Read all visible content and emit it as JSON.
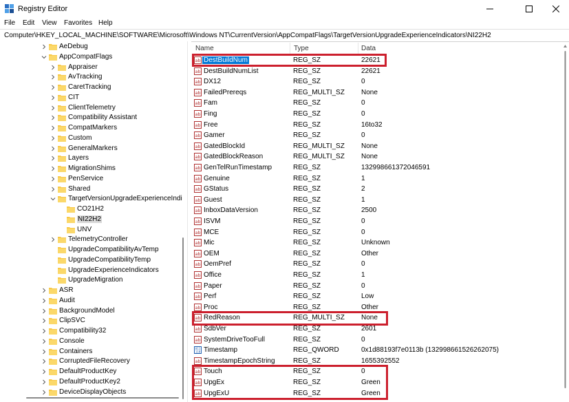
{
  "window": {
    "title": "Registry Editor"
  },
  "menu": [
    "File",
    "Edit",
    "View",
    "Favorites",
    "Help"
  ],
  "address": "Computer\\HKEY_LOCAL_MACHINE\\SOFTWARE\\Microsoft\\Windows NT\\CurrentVersion\\AppCompatFlags\\TargetVersionUpgradeExperienceIndicators\\NI22H2",
  "tree": [
    {
      "label": "AeDebug",
      "level": 3,
      "chev": "right"
    },
    {
      "label": "AppCompatFlags",
      "level": 3,
      "chev": "down"
    },
    {
      "label": "Appraiser",
      "level": 4,
      "chev": "right"
    },
    {
      "label": "AvTracking",
      "level": 4,
      "chev": "right"
    },
    {
      "label": "CaretTracking",
      "level": 4,
      "chev": "right"
    },
    {
      "label": "CIT",
      "level": 4,
      "chev": "right"
    },
    {
      "label": "ClientTelemetry",
      "level": 4,
      "chev": "right"
    },
    {
      "label": "Compatibility Assistant",
      "level": 4,
      "chev": "right"
    },
    {
      "label": "CompatMarkers",
      "level": 4,
      "chev": "right"
    },
    {
      "label": "Custom",
      "level": 4,
      "chev": "right"
    },
    {
      "label": "GeneralMarkers",
      "level": 4,
      "chev": "right"
    },
    {
      "label": "Layers",
      "level": 4,
      "chev": "right"
    },
    {
      "label": "MigrationShims",
      "level": 4,
      "chev": "right"
    },
    {
      "label": "PenService",
      "level": 4,
      "chev": "right"
    },
    {
      "label": "Shared",
      "level": 4,
      "chev": "right"
    },
    {
      "label": "TargetVersionUpgradeExperienceIndi",
      "level": 4,
      "chev": "down"
    },
    {
      "label": "CO21H2",
      "level": 5,
      "chev": "none"
    },
    {
      "label": "NI22H2",
      "level": 5,
      "chev": "none",
      "selected": true
    },
    {
      "label": "UNV",
      "level": 5,
      "chev": "none"
    },
    {
      "label": "TelemetryController",
      "level": 4,
      "chev": "right"
    },
    {
      "label": "UpgradeCompatibilityAvTemp",
      "level": 4,
      "chev": "none"
    },
    {
      "label": "UpgradeCompatibilityTemp",
      "level": 4,
      "chev": "none"
    },
    {
      "label": "UpgradeExperienceIndicators",
      "level": 4,
      "chev": "none"
    },
    {
      "label": "UpgradeMigration",
      "level": 4,
      "chev": "none"
    },
    {
      "label": "ASR",
      "level": 3,
      "chev": "right"
    },
    {
      "label": "Audit",
      "level": 3,
      "chev": "right"
    },
    {
      "label": "BackgroundModel",
      "level": 3,
      "chev": "right"
    },
    {
      "label": "ClipSVC",
      "level": 3,
      "chev": "right"
    },
    {
      "label": "Compatibility32",
      "level": 3,
      "chev": "right"
    },
    {
      "label": "Console",
      "level": 3,
      "chev": "right"
    },
    {
      "label": "Containers",
      "level": 3,
      "chev": "right"
    },
    {
      "label": "CorruptedFileRecovery",
      "level": 3,
      "chev": "right"
    },
    {
      "label": "DefaultProductKey",
      "level": 3,
      "chev": "right"
    },
    {
      "label": "DefaultProductKey2",
      "level": 3,
      "chev": "right"
    },
    {
      "label": "DeviceDisplayObjects",
      "level": 3,
      "chev": "right"
    }
  ],
  "columns": {
    "name": "Name",
    "type": "Type",
    "data": "Data"
  },
  "values": [
    {
      "name": "DestBuildNum",
      "type": "REG_SZ",
      "data": "22621",
      "selected": true
    },
    {
      "name": "DestBuildNumList",
      "type": "REG_SZ",
      "data": "22621"
    },
    {
      "name": "DX12",
      "type": "REG_SZ",
      "data": "0"
    },
    {
      "name": "FailedPrereqs",
      "type": "REG_MULTI_SZ",
      "data": "None"
    },
    {
      "name": "Fam",
      "type": "REG_SZ",
      "data": "0"
    },
    {
      "name": "Fing",
      "type": "REG_SZ",
      "data": "0"
    },
    {
      "name": "Free",
      "type": "REG_SZ",
      "data": "16to32"
    },
    {
      "name": "Gamer",
      "type": "REG_SZ",
      "data": "0"
    },
    {
      "name": "GatedBlockId",
      "type": "REG_MULTI_SZ",
      "data": "None"
    },
    {
      "name": "GatedBlockReason",
      "type": "REG_MULTI_SZ",
      "data": "None"
    },
    {
      "name": "GenTelRunTimestamp",
      "type": "REG_SZ",
      "data": "132998661372046591"
    },
    {
      "name": "Genuine",
      "type": "REG_SZ",
      "data": "1"
    },
    {
      "name": "GStatus",
      "type": "REG_SZ",
      "data": "2"
    },
    {
      "name": "Guest",
      "type": "REG_SZ",
      "data": "1"
    },
    {
      "name": "InboxDataVersion",
      "type": "REG_SZ",
      "data": "2500"
    },
    {
      "name": "ISVM",
      "type": "REG_SZ",
      "data": "0"
    },
    {
      "name": "MCE",
      "type": "REG_SZ",
      "data": "0"
    },
    {
      "name": "Mic",
      "type": "REG_SZ",
      "data": "Unknown"
    },
    {
      "name": "OEM",
      "type": "REG_SZ",
      "data": "Other"
    },
    {
      "name": "OemPref",
      "type": "REG_SZ",
      "data": "0"
    },
    {
      "name": "Office",
      "type": "REG_SZ",
      "data": "1"
    },
    {
      "name": "Paper",
      "type": "REG_SZ",
      "data": "0"
    },
    {
      "name": "Perf",
      "type": "REG_SZ",
      "data": "Low"
    },
    {
      "name": "Proc",
      "type": "REG_SZ",
      "data": "Other"
    },
    {
      "name": "RedReason",
      "type": "REG_MULTI_SZ",
      "data": "None"
    },
    {
      "name": "SdbVer",
      "type": "REG_SZ",
      "data": "2601"
    },
    {
      "name": "SystemDriveTooFull",
      "type": "REG_SZ",
      "data": "0"
    },
    {
      "name": "Timestamp",
      "type": "REG_QWORD",
      "data": "0x1d88193f7e0113b (132998661526262075)",
      "bin": true
    },
    {
      "name": "TimestampEpochString",
      "type": "REG_SZ",
      "data": "1655392552"
    },
    {
      "name": "Touch",
      "type": "REG_SZ",
      "data": "0"
    },
    {
      "name": "UpgEx",
      "type": "REG_SZ",
      "data": "Green"
    },
    {
      "name": "UpgExU",
      "type": "REG_SZ",
      "data": "Green"
    }
  ],
  "colors": {
    "highlight": "#cc1f2d",
    "selection": "#0078d7",
    "folder": "#f8c846"
  }
}
